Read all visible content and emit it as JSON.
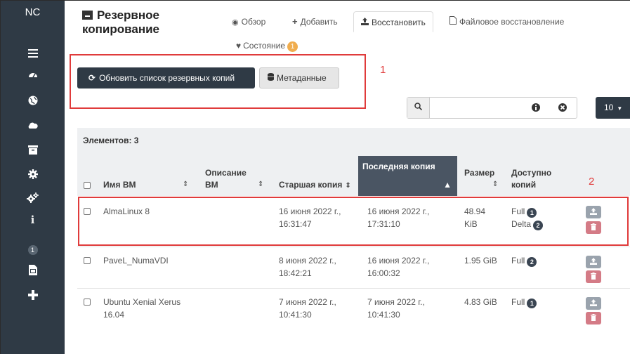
{
  "sidebar": {
    "brand": "NC",
    "badge": "1"
  },
  "header": {
    "title_line1": "Резервное",
    "title_line2": "копирование",
    "tabs": [
      {
        "label": "Обзор",
        "icon": "eye-icon"
      },
      {
        "label": "Добавить",
        "icon": "plus-icon"
      },
      {
        "label": "Восстановить",
        "icon": "upload-icon"
      },
      {
        "label": "Файловое восстановление",
        "icon": "file-icon"
      }
    ],
    "status_tab": {
      "label": "Состояние",
      "badge": "1",
      "icon": "heartbeat-icon"
    }
  },
  "toolbar": {
    "refresh_label": "Обновить список резервных копий",
    "metadata_label": "Метаданные",
    "search_value": "",
    "per_page": "10"
  },
  "annotations": {
    "one": "1",
    "two": "2"
  },
  "table": {
    "count_label": "Элементов: 3",
    "columns": {
      "vm_name": "Имя ВМ",
      "desc_line1": "Описание",
      "desc_line2": "ВМ",
      "oldest": "Старшая копия",
      "latest": "Последняя копия",
      "size_line1": "Размер",
      "avail_line1": "Доступно",
      "avail_line2": "копий"
    },
    "rows": [
      {
        "name_line1": "AlmaLinux 8",
        "name_line2": "",
        "oldest_line1": "16 июня 2022 г.,",
        "oldest_line2": "16:31:47",
        "latest_line1": "16 июня 2022 г.,",
        "latest_line2": "17:31:10",
        "size_line1": "48.94",
        "size_line2": "KiB",
        "copies": [
          {
            "type": "Full",
            "count": "1"
          },
          {
            "type": "Delta",
            "count": "2"
          }
        ]
      },
      {
        "name_line1": "PaveL_NumaVDI",
        "name_line2": "",
        "oldest_line1": "8 июня 2022 г.,",
        "oldest_line2": "18:42:21",
        "latest_line1": "16 июня 2022 г.,",
        "latest_line2": "16:00:32",
        "size_line1": "1.95 GiB",
        "size_line2": "",
        "copies": [
          {
            "type": "Full",
            "count": "2"
          }
        ]
      },
      {
        "name_line1": "Ubuntu Xenial Xerus",
        "name_line2": "16.04",
        "oldest_line1": "7 июня 2022 г.,",
        "oldest_line2": "10:41:30",
        "latest_line1": "7 июня 2022 г.,",
        "latest_line2": "10:41:30",
        "size_line1": "4.83 GiB",
        "size_line2": "",
        "copies": [
          {
            "type": "Full",
            "count": "1"
          }
        ]
      }
    ]
  },
  "colors": {
    "sidebar": "#2f3a45",
    "annotation": "#e03b3b",
    "badge_warning": "#f0ad4e",
    "delete": "#d47b86",
    "restore": "#9aa3ad"
  }
}
